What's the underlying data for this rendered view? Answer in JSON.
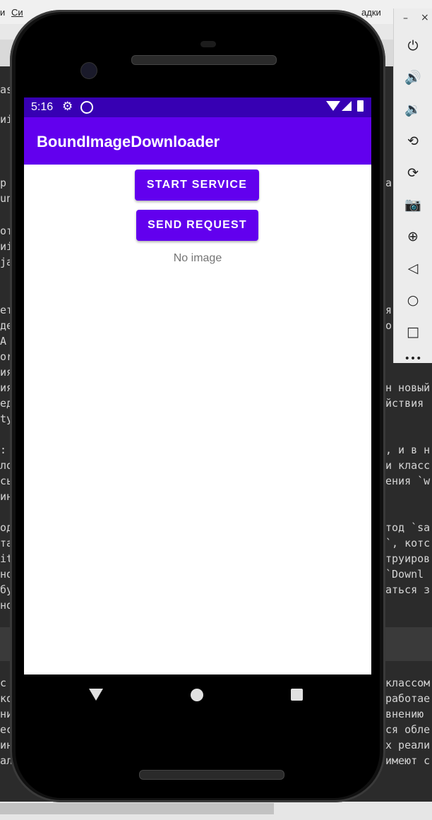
{
  "background": {
    "menu": [
      "и",
      "Си",
      "адки"
    ],
    "code_lines": [
      {
        "left": "as",
        "right": ""
      },
      {
        "left": "иі",
        "right": ""
      },
      {
        "left": "р",
        "right": "а"
      },
      {
        "left": "un",
        "right": ""
      },
      {
        "left": "от",
        "right": ""
      },
      {
        "left": "иі",
        "right": ""
      },
      {
        "left": "ja",
        "right": ""
      },
      {
        "left": "ет",
        "right": "я"
      },
      {
        "left": "де",
        "right": "о"
      },
      {
        "left": "А",
        "right": ""
      },
      {
        "left": "or",
        "right": ""
      },
      {
        "left": "ия",
        "right": ""
      },
      {
        "left": "ия",
        "right": "н новый"
      },
      {
        "left": "ед",
        "right": "йствия"
      },
      {
        "left": "ty",
        "right": ""
      },
      {
        "left": ":",
        "right": ", и в н"
      },
      {
        "left": "ло",
        "right": "и класс"
      },
      {
        "left": "сь",
        "right": "ения `w"
      },
      {
        "left": "ин",
        "right": ""
      },
      {
        "left": "од",
        "right": "тод `sa"
      },
      {
        "left": "та",
        "right": "`, котс"
      },
      {
        "left": "it",
        "right": "труиров"
      },
      {
        "left": "но",
        "right": "`Downl"
      },
      {
        "left": "бу",
        "right": "аться з"
      },
      {
        "left": "но",
        "right": ""
      },
      {
        "left": "с",
        "right": "классом"
      },
      {
        "left": "ко",
        "right": "работае"
      },
      {
        "left": "ни",
        "right": "внению"
      },
      {
        "left": "ес",
        "right": "ся обле"
      },
      {
        "left": "ин",
        "right": "х реали"
      },
      {
        "left": "ал",
        "right": "имеют с"
      }
    ]
  },
  "status_bar": {
    "time": "5:16",
    "icons": [
      "gear-icon",
      "sync-icon",
      "wifi-icon",
      "signal-icon",
      "battery-icon"
    ]
  },
  "app_bar": {
    "title": "BoundImageDownloader"
  },
  "main": {
    "start_service_label": "START SERVICE",
    "send_request_label": "SEND REQUEST",
    "status_text": "No image"
  },
  "navigation": {
    "icons": [
      "back-icon",
      "home-icon",
      "recents-icon"
    ]
  },
  "emulator_toolbar": {
    "window_controls": [
      "–",
      "×"
    ],
    "buttons": [
      "power-icon",
      "volume-up-icon",
      "volume-down-icon",
      "rotate-left-icon",
      "rotate-right-icon",
      "camera-icon",
      "zoom-icon",
      "back-icon",
      "home-icon",
      "overview-icon",
      "more-icon"
    ]
  },
  "colors": {
    "primary": "#6200ee",
    "primary_dark": "#3700b3",
    "status_text": "#757575"
  }
}
